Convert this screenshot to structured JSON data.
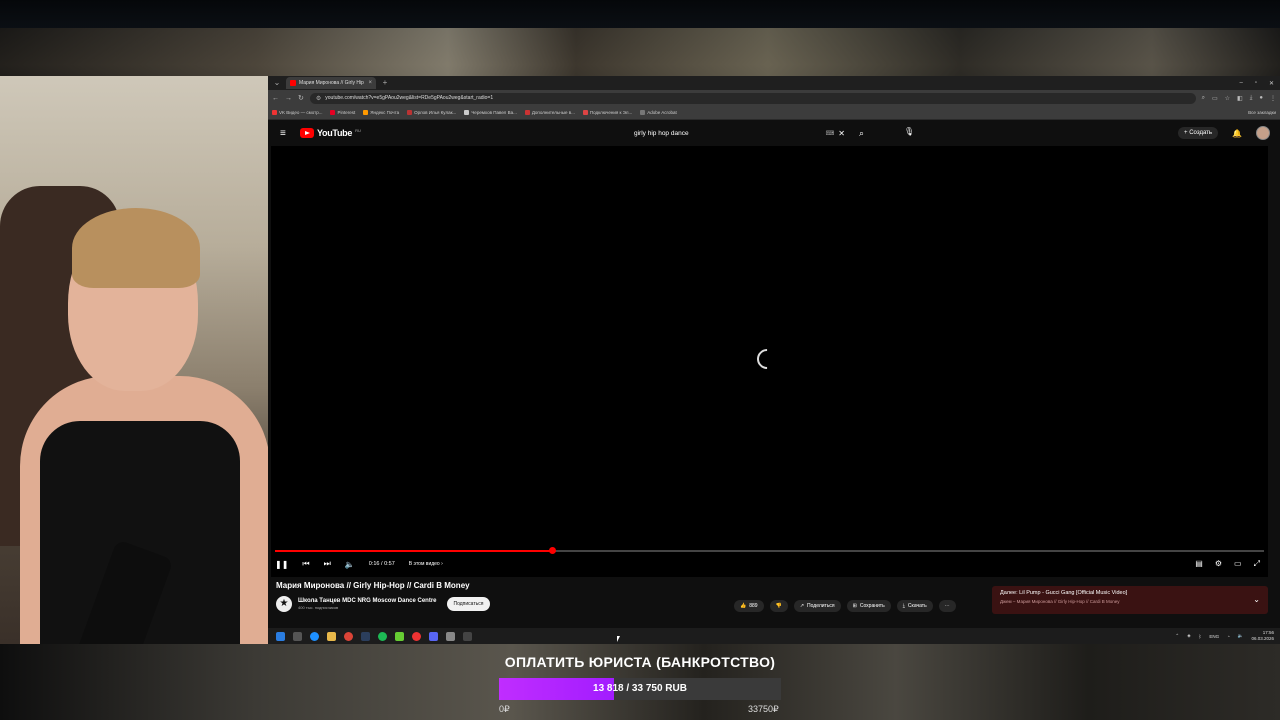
{
  "browser": {
    "tab_title": "Мария Миронова // Girly Hip",
    "url": "youtube.com/watch?v=e5gPAou2weg&list=RDe5gPAou2weg&start_radio=1",
    "bookmarks": [
      {
        "label": "VK Видео — смотр..."
      },
      {
        "label": "Pinterest"
      },
      {
        "label": "Яндекс Почта"
      },
      {
        "label": "Орлов Илья Кулак..."
      },
      {
        "label": "Черемхов Павел Ва..."
      },
      {
        "label": "Дополнительные в..."
      },
      {
        "label": "Подключения к Эл..."
      },
      {
        "label": "Adobe Acrobat"
      }
    ],
    "all_bookmarks": "Все закладки"
  },
  "youtube": {
    "logo_text": "YouTube",
    "region": "RU",
    "search_value": "girly hip hop dance",
    "create_label": "Создать"
  },
  "player": {
    "progress": 0.28,
    "time": "0:16 / 0:57",
    "chapters": "В этом видео"
  },
  "video": {
    "title": "Мария Миронова // Girly Hip-Hop // Cardi B Money",
    "channel_name": "Школа Танцев MDC NRG Moscow Dance Centre",
    "subscribers": "400 тыс. подписчиков",
    "subscribe_label": "Подписаться",
    "likes": "889",
    "share_label": "Поделиться",
    "save_label": "Сохранить",
    "download_label": "Скачать"
  },
  "upnext": {
    "title": "Далее: Lil Pump - Gucci Gang [Official Music Video]",
    "subtitle": "Джем – Мария Миронова // Girly Hip-Hop // Cardi B Money"
  },
  "taskbar": {
    "lang": "ENG",
    "time": "17:56",
    "date": "06.03.2026"
  },
  "overlay": {
    "goal_title": "ОПЛАТИТЬ ЮРИСТА (БАНКРОТСТВО)",
    "goal_progress_text": "13 818 / 33 750 RUB",
    "goal_current": 13818,
    "goal_target": 33750,
    "goal_min_label": "0₽",
    "goal_max_label": "33750₽",
    "accent": "#b323ff"
  }
}
